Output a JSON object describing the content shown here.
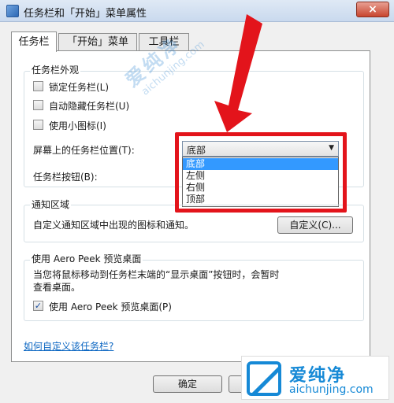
{
  "window": {
    "title": "任务栏和「开始」菜单属性",
    "close_glyph": "×"
  },
  "tabs": [
    {
      "label": "任务栏"
    },
    {
      "label": "「开始」菜单"
    },
    {
      "label": "工具栏"
    }
  ],
  "appearance": {
    "group_title": "任务栏外观",
    "lock_taskbar": {
      "label": "锁定任务栏(L)",
      "checked": false
    },
    "auto_hide": {
      "label": "自动隐藏任务栏(U)",
      "checked": false
    },
    "small_icons": {
      "label": "使用小图标(I)",
      "checked": false
    },
    "position_label": "屏幕上的任务栏位置(T):",
    "position_value": "底部",
    "position_options": [
      "底部",
      "左侧",
      "右侧",
      "顶部"
    ],
    "buttons_label": "任务栏按钮(B):"
  },
  "notification": {
    "group_title": "通知区域",
    "description": "自定义通知区域中出现的图标和通知。",
    "customize_button": "自定义(C)..."
  },
  "aero_peek": {
    "group_title": "使用 Aero Peek 预览桌面",
    "description_line1": "当您将鼠标移动到任务栏末端的“显示桌面”按钮时，会暂时",
    "description_line2": "查看桌面。",
    "use_peek": {
      "label": "使用 Aero Peek 预览桌面(P)",
      "checked": true,
      "check_glyph": "✓"
    }
  },
  "help_link": "如何自定义该任务栏?",
  "buttons": {
    "ok": "确定"
  },
  "watermark": {
    "name": "爱纯净",
    "url": "aichunjing.com"
  },
  "colors": {
    "annotation_red": "#e3141b",
    "selection_blue": "#3399ff",
    "link_blue": "#0b66c2"
  }
}
